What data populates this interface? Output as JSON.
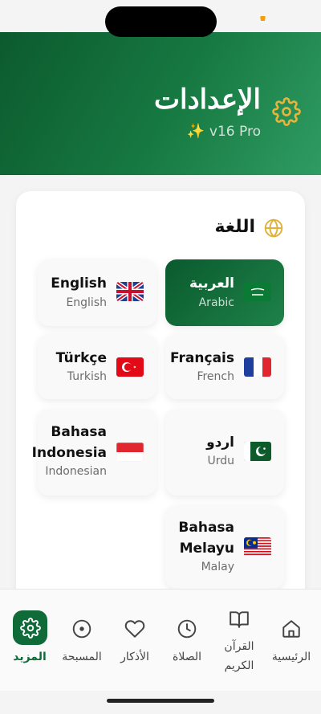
{
  "header": {
    "title": "الإعدادات",
    "version": "v16 Pro",
    "sparkle": "✨"
  },
  "language_section": {
    "title": "اللغة",
    "options": [
      {
        "name": "العربية",
        "sub": "Arabic",
        "flag": "saudi-arabia",
        "selected": true
      },
      {
        "name": "English",
        "sub": "English",
        "flag": "united-kingdom",
        "selected": false
      },
      {
        "name": "Français",
        "sub": "French",
        "flag": "france",
        "selected": false
      },
      {
        "name": "Türkçe",
        "sub": "Turkish",
        "flag": "turkey",
        "selected": false
      },
      {
        "name": "اردو",
        "sub": "Urdu",
        "flag": "pakistan",
        "selected": false
      },
      {
        "name_line1": "Bahasa",
        "name_line2": "Indonesia",
        "sub": "Indonesian",
        "flag": "indonesia",
        "selected": false
      },
      {
        "name_line1": "Bahasa",
        "name_line2": "Melayu",
        "sub": "Malay",
        "flag": "malaysia",
        "selected": false
      }
    ]
  },
  "nav": {
    "items": [
      {
        "label": "الرئيسية",
        "icon": "home-icon"
      },
      {
        "label_line1": "القرآن",
        "label_line2": "الكريم",
        "icon": "book-icon"
      },
      {
        "label": "الصلاة",
        "icon": "clock-icon"
      },
      {
        "label": "الأذكار",
        "icon": "heart-icon"
      },
      {
        "label": "المسبحة",
        "icon": "tasbih-icon"
      },
      {
        "label": "المزيد",
        "icon": "gear-icon",
        "active": true
      }
    ]
  },
  "colors": {
    "primary": "#0f6b38",
    "accent": "#e0b13b"
  }
}
